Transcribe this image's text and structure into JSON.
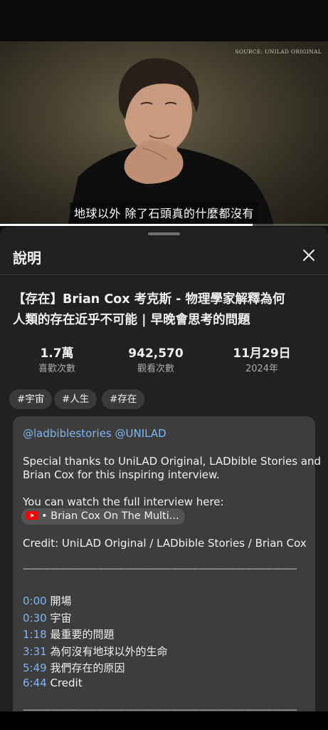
{
  "video": {
    "source_label": "SOURCE: UNILAD ORIGINAL",
    "subtitle": "地球以外  除了石頭真的什麼都沒有",
    "progress": 0.77
  },
  "sheet": {
    "title": "說明",
    "close_icon": "close-icon"
  },
  "video_info": {
    "title_line1": "【存在】Brian Cox 考克斯 - 物理學家解釋為何",
    "title_line2": "人類的存在近乎不可能 | 早晚會思考的問題",
    "stats": [
      {
        "value": "1.7萬",
        "label": "喜歡次數"
      },
      {
        "value": "942,570",
        "label": "觀看次數"
      },
      {
        "value": "11月29日",
        "label": "2024年"
      }
    ],
    "tags": [
      "#宇宙",
      "#人生",
      "#存在"
    ]
  },
  "description": {
    "handles": "@ladbiblestories @UNILAD",
    "thanks_line1": "Special thanks to UniLAD Original, LADbible Stories and",
    "thanks_line2": "Brian Cox for this inspiring interview.",
    "full_interview": "You can watch the full interview here:",
    "chip_label": "• Brian Cox On The Multi...",
    "credit": "Credit: UniLAD Original / LADbible Stories / Brian Cox",
    "rule": "————————————————————————————————",
    "chapters": [
      {
        "time": "0:00",
        "title": "開場"
      },
      {
        "time": "0:30",
        "title": "宇宙"
      },
      {
        "time": "1:18",
        "title": "最重要的問題"
      },
      {
        "time": "3:31",
        "title": "為何沒有地球以外的生命"
      },
      {
        "time": "5:49",
        "title": "我們存在的原因"
      },
      {
        "time": "6:44",
        "title": "Credit"
      }
    ]
  },
  "colors": {
    "link": "#7fb6f6",
    "youtube_red": "#ff0000"
  }
}
